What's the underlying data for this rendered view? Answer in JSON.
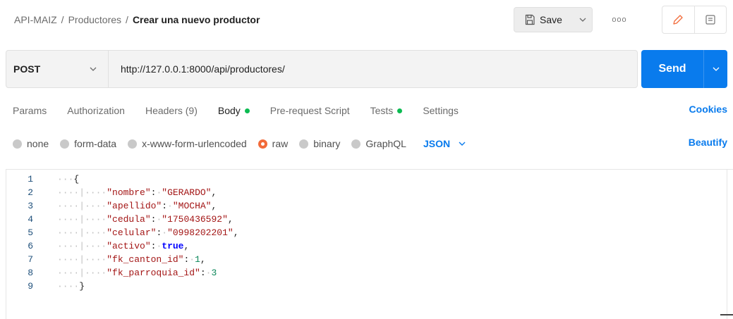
{
  "breadcrumb": {
    "collection": "API-MAIZ",
    "folder": "Productores",
    "separator": "/",
    "request": "Crear una nuevo productor"
  },
  "toolbar": {
    "save_label": "Save",
    "save_icon": "save-icon",
    "more_label": "ooo",
    "edit_icon": "pencil-icon",
    "docs_icon": "comment-icon"
  },
  "request": {
    "method": "POST",
    "url": "http://127.0.0.1:8000/api/productores/",
    "send_label": "Send"
  },
  "tabs": [
    {
      "label": "Params",
      "dot": false
    },
    {
      "label": "Authorization",
      "dot": false
    },
    {
      "label": "Headers (9)",
      "dot": false
    },
    {
      "label": "Body",
      "dot": true,
      "active": true
    },
    {
      "label": "Pre-request Script",
      "dot": false
    },
    {
      "label": "Tests",
      "dot": true
    },
    {
      "label": "Settings",
      "dot": false
    }
  ],
  "cookies_label": "Cookies",
  "body_types": [
    {
      "label": "none",
      "selected": false
    },
    {
      "label": "form-data",
      "selected": false
    },
    {
      "label": "x-www-form-urlencoded",
      "selected": false
    },
    {
      "label": "raw",
      "selected": true
    },
    {
      "label": "binary",
      "selected": false
    },
    {
      "label": "GraphQL",
      "selected": false
    }
  ],
  "format": "JSON",
  "beautify_label": "Beautify",
  "editor": {
    "line_numbers": [
      "1",
      "2",
      "3",
      "4",
      "5",
      "6",
      "7",
      "8",
      "9"
    ],
    "open_brace": "{",
    "close_brace": "}",
    "fields": [
      {
        "key": "\"nombre\"",
        "value": "\"GERARDO\"",
        "comma": ","
      },
      {
        "key": "\"apellido\"",
        "value": "\"MOCHA\"",
        "comma": ","
      },
      {
        "key": "\"cedula\"",
        "value": "\"1750436592\"",
        "comma": ","
      },
      {
        "key": "\"celular\"",
        "value": "\"0998202201\"",
        "comma": ","
      },
      {
        "key": "\"activo\"",
        "value": "true",
        "comma": ","
      },
      {
        "key": "\"fk_canton_id\"",
        "value": "1",
        "comma": ","
      },
      {
        "key": "\"fk_parroquia_id\"",
        "value": "3",
        "comma": ""
      }
    ]
  },
  "colors": {
    "accent_blue": "#097bed",
    "dot_green": "#0cbb52",
    "radio_selected": "#f26b3a"
  }
}
